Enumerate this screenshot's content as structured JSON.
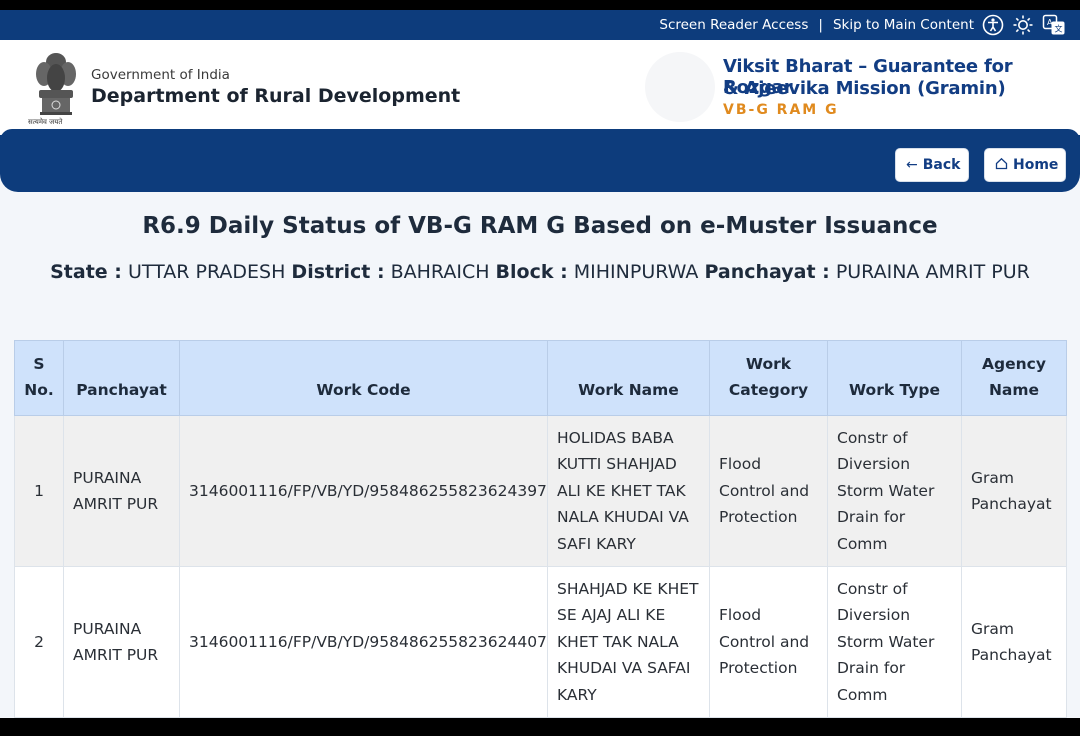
{
  "topbar": {
    "screen_reader": "Screen Reader Access",
    "separator": "|",
    "skip": "Skip to Main Content"
  },
  "header": {
    "gov_small": "Government of India",
    "gov_big": "Department of Rural Development",
    "emblem_caption": "सत्यमेव जयते",
    "mission_line1": "Viksit Bharat – Guarantee for Rozgar",
    "mission_line2": "& Ajeevika Mission (Gramin)",
    "mission_line3": "VB-G RAM G"
  },
  "nav": {
    "back_label": "Back",
    "home_label": "Home"
  },
  "report": {
    "title": "R6.9 Daily Status of VB-G RAM G Based on e-Muster Issuance",
    "state_label": "State :",
    "state_value": "UTTAR PRADESH",
    "district_label": "District :",
    "district_value": "BAHRAICH",
    "block_label": "Block :",
    "block_value": "MIHINPURWA",
    "panchayat_label": "Panchayat :",
    "panchayat_value": "PURAINA AMRIT PUR"
  },
  "table": {
    "headers": {
      "sno_line1": "S",
      "sno_line2": "No.",
      "panchayat": "Panchayat",
      "work_code": "Work Code",
      "work_name": "Work Name",
      "work_category_line1": "Work",
      "work_category_line2": "Category",
      "work_type": "Work Type",
      "agency_line1": "Agency",
      "agency_line2": "Name"
    },
    "rows": [
      {
        "sno": "1",
        "panchayat": "PURAINA AMRIT PUR",
        "work_code": "3146001116/FP/VB/YD/958486255823624397",
        "work_name": "HOLIDAS BABA KUTTI SHAHJAD ALI KE KHET TAK NALA KHUDAI VA SAFI KARY",
        "work_category": "Flood Control and Protection",
        "work_type": "Constr of Diversion Storm Water Drain for Comm",
        "agency": "Gram Panchayat"
      },
      {
        "sno": "2",
        "panchayat": "PURAINA AMRIT PUR",
        "work_code": "3146001116/FP/VB/YD/958486255823624407",
        "work_name": "SHAHJAD KE KHET SE AJAJ ALI KE KHET TAK NALA KHUDAI VA SAFAI KARY",
        "work_category": "Flood Control and Protection",
        "work_type": "Constr of Diversion Storm Water Drain for Comm",
        "agency": "Gram Panchayat"
      }
    ]
  },
  "colors": {
    "primary_blue": "#0d3c7c",
    "accent_orange": "#e08a1e",
    "header_cell": "#cfe2fb"
  }
}
